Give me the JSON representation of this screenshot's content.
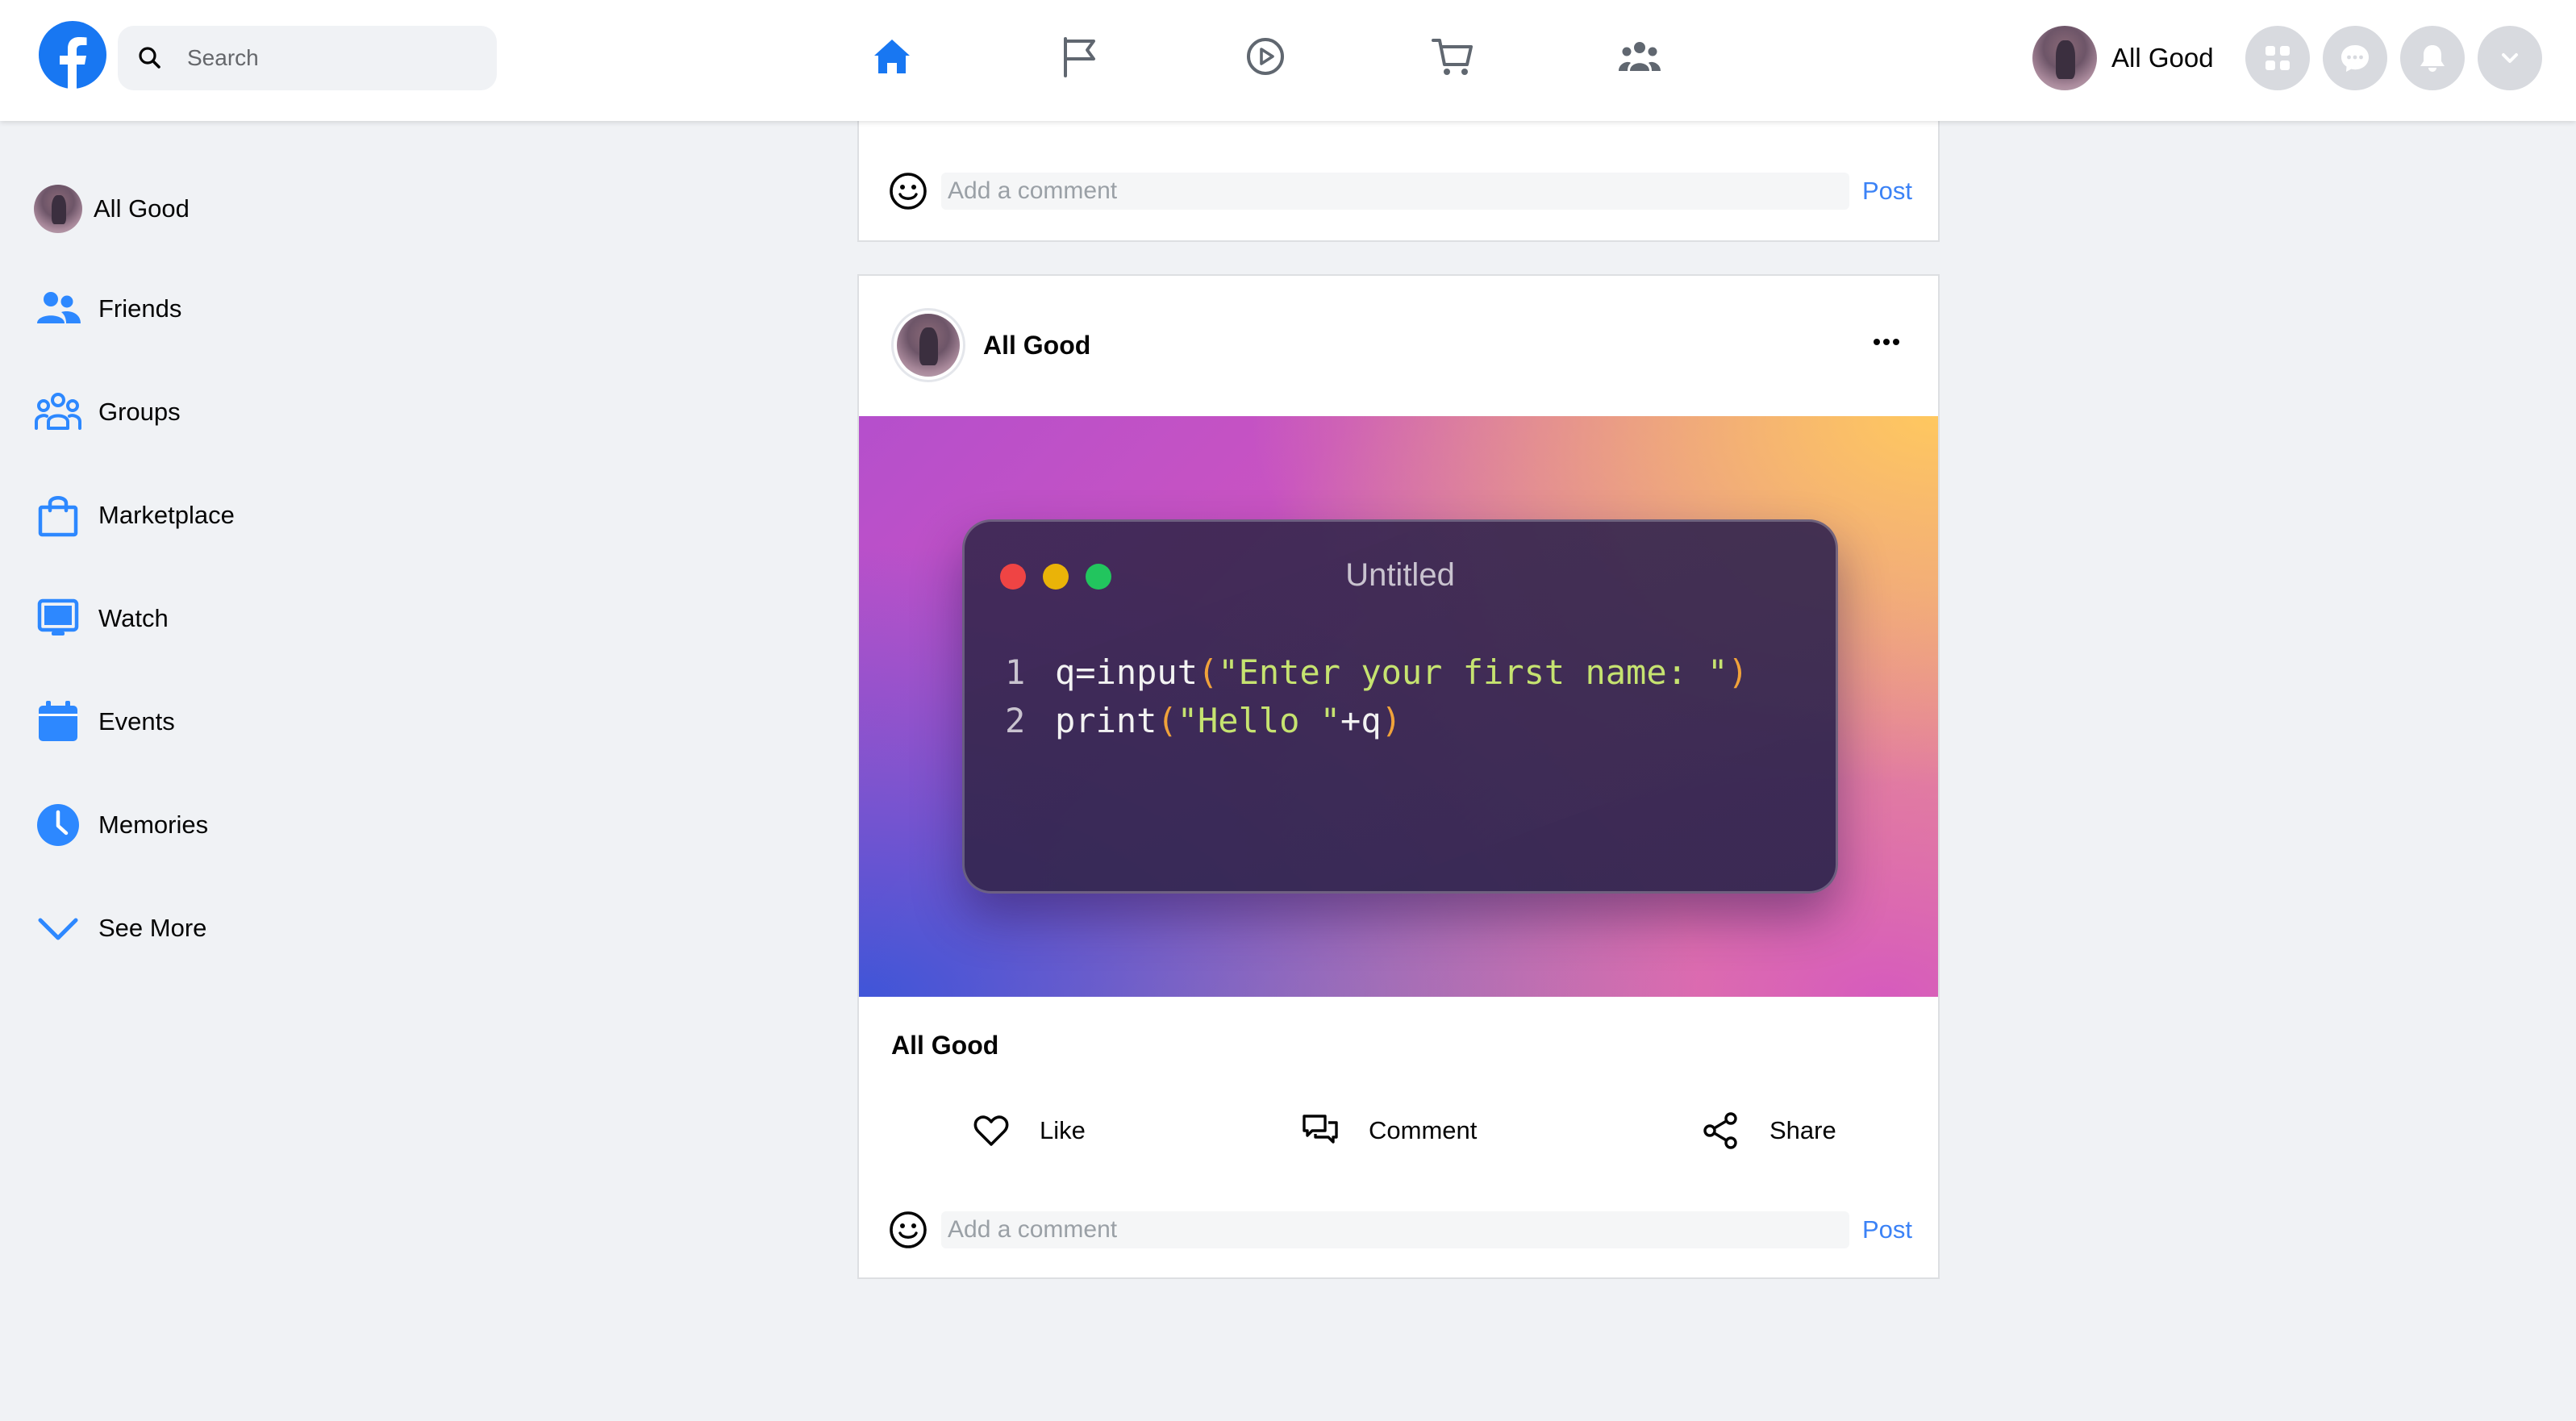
{
  "app": {
    "brand_color": "#1877f2",
    "accent_color": "#3b82f6"
  },
  "header": {
    "search": {
      "placeholder": "Search",
      "value": ""
    },
    "nav_icons": [
      "home-icon",
      "flag-icon",
      "watch-play-icon",
      "marketplace-cart-icon",
      "groups-icon"
    ],
    "profile_name": "All Good",
    "right_buttons": [
      "menu-grid-icon",
      "messenger-icon",
      "notifications-bell-icon",
      "account-chevron-down-icon"
    ]
  },
  "sidebar": {
    "items": [
      {
        "label": "All Good",
        "icon": "avatar"
      },
      {
        "label": "Friends",
        "icon": "friends-icon"
      },
      {
        "label": "Groups",
        "icon": "groups-icon"
      },
      {
        "label": "Marketplace",
        "icon": "shopping-bag-icon"
      },
      {
        "label": "Watch",
        "icon": "monitor-icon"
      },
      {
        "label": "Events",
        "icon": "calendar-icon"
      },
      {
        "label": "Memories",
        "icon": "clock-icon"
      },
      {
        "label": "See More",
        "icon": "chevron-down-icon"
      }
    ]
  },
  "previous_post": {
    "comment": {
      "placeholder": "Add a comment",
      "value": "",
      "post_label": "Post"
    }
  },
  "post": {
    "author": "All Good",
    "image": {
      "window_title": "Untitled",
      "code_lines": [
        {
          "number": "1",
          "tokens": [
            "q=input",
            "(",
            "\"Enter your first name: \"",
            ")"
          ]
        },
        {
          "number": "2",
          "tokens": [
            "print",
            "(",
            "\"Hello \"",
            "+q",
            ")"
          ]
        }
      ]
    },
    "caption": "All Good",
    "actions": {
      "like": "Like",
      "comment": "Comment",
      "share": "Share"
    },
    "comment": {
      "placeholder": "Add a comment",
      "value": "",
      "post_label": "Post"
    }
  }
}
